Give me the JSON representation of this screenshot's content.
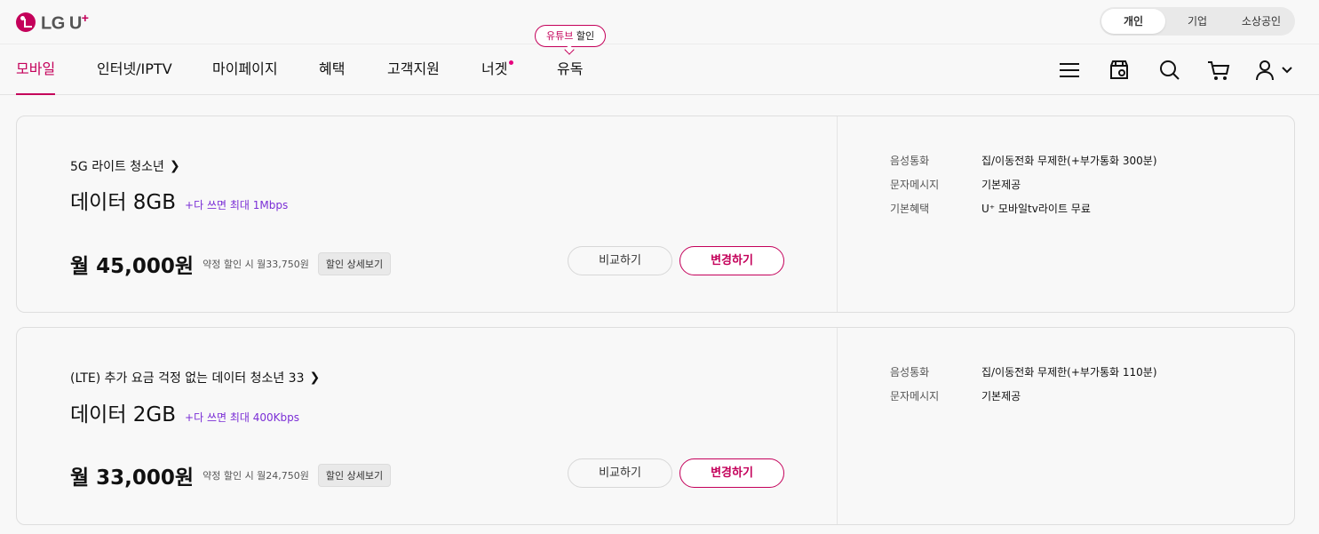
{
  "logo": {
    "text": "LG U",
    "plus": "+"
  },
  "segments": [
    "개인",
    "기업",
    "소상공인"
  ],
  "nav": {
    "items": [
      "모바일",
      "인터넷/IPTV",
      "마이페이지",
      "혜택",
      "고객지원",
      "너겟",
      "유독"
    ],
    "bubble": {
      "pink": "유튜브",
      "text": " 할인"
    }
  },
  "icons": [
    "menu-icon",
    "store-icon",
    "search-icon",
    "cart-icon",
    "user-icon",
    "chevron-down-icon"
  ],
  "colors": {
    "brand": "#c4005a",
    "accent": "#7b2fd6"
  },
  "plans": [
    {
      "name": "5G 라이트 청소년",
      "data": "데이터 8GB",
      "data_sub": "+다 쓰면 최대 1Mbps",
      "price": "월 45,000원",
      "discount": "약정 할인 시 월33,750원",
      "detail_btn": "할인 상세보기",
      "compare_btn": "비교하기",
      "change_btn": "변경하기",
      "specs": [
        {
          "k": "음성통화",
          "v": "집/이동전화 무제한(+부가통화 300분)"
        },
        {
          "k": "문자메시지",
          "v": "기본제공"
        },
        {
          "k": "기본혜택",
          "v": "U⁺ 모바일tv라이트 무료"
        }
      ]
    },
    {
      "name": "(LTE) 추가 요금 걱정 없는 데이터 청소년 33",
      "data": "데이터 2GB",
      "data_sub": "+다 쓰면 최대 400Kbps",
      "price": "월 33,000원",
      "discount": "약정 할인 시 월24,750원",
      "detail_btn": "할인 상세보기",
      "compare_btn": "비교하기",
      "change_btn": "변경하기",
      "specs": [
        {
          "k": "음성통화",
          "v": "집/이동전화 무제한(+부가통화 110분)"
        },
        {
          "k": "문자메시지",
          "v": "기본제공"
        }
      ]
    }
  ]
}
